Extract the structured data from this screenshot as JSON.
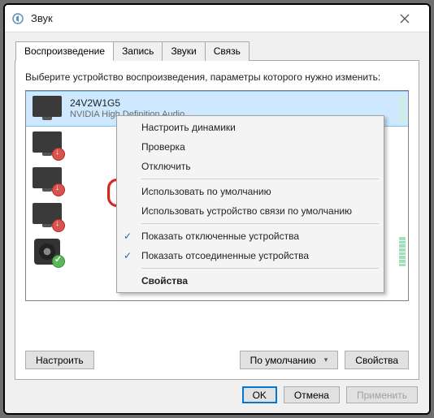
{
  "window": {
    "title": "Звук"
  },
  "tabs": {
    "playback": "Воспроизведение",
    "recording": "Запись",
    "sounds": "Звуки",
    "comm": "Связь"
  },
  "instruction": "Выберите устройство воспроизведения, параметры которого нужно изменить:",
  "devices": {
    "d0": {
      "name": "24V2W1G5",
      "sub": "NVIDIA High Definition Audio"
    }
  },
  "context_menu": {
    "configure_speakers": "Настроить динамики",
    "test": "Проверка",
    "disable": "Отключить",
    "set_default": "Использовать по умолчанию",
    "set_default_comm": "Использовать устройство связи по умолчанию",
    "show_disabled": "Показать отключенные устройства",
    "show_disconnected": "Показать отсоединенные устройства",
    "properties": "Свойства"
  },
  "buttons": {
    "configure": "Настроить",
    "set_default": "По умолчанию",
    "properties": "Свойства",
    "ok": "OK",
    "cancel": "Отмена",
    "apply": "Применить"
  }
}
